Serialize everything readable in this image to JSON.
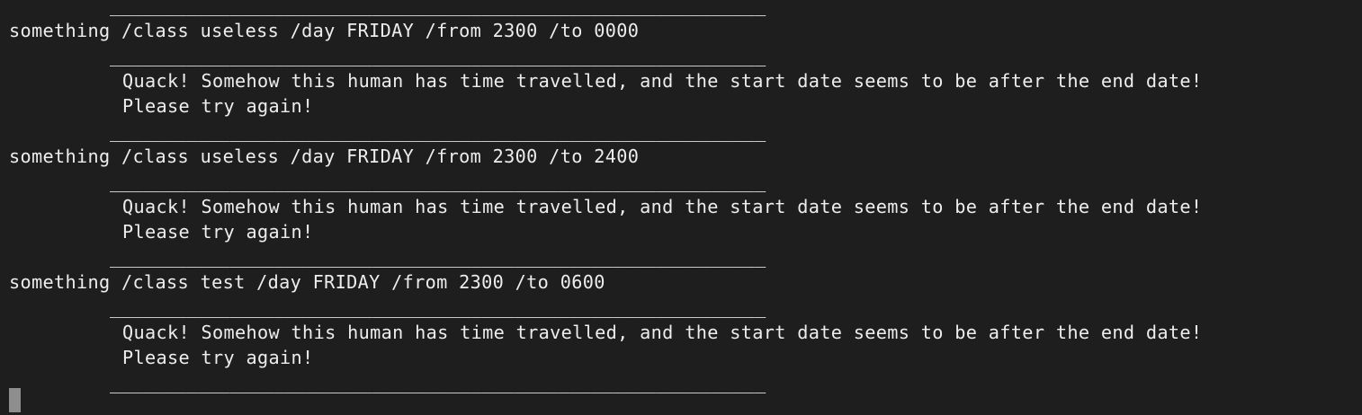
{
  "terminal": {
    "divider": "____________________________________________________________",
    "blocks": [
      {
        "command": "something /class useless /day FRIDAY /from 2300 /to 0000",
        "message_line1": "Quack! Somehow this human has time travelled, and the start date seems to be after the end date!",
        "message_line2": "Please try again!"
      },
      {
        "command": "something /class useless /day FRIDAY /from 2300 /to 2400",
        "message_line1": "Quack! Somehow this human has time travelled, and the start date seems to be after the end date!",
        "message_line2": "Please try again!"
      },
      {
        "command": "something /class test /day FRIDAY /from 2300 /to 0600",
        "message_line1": "Quack! Somehow this human has time travelled, and the start date seems to be after the end date!",
        "message_line2": "Please try again!"
      }
    ]
  },
  "colors": {
    "background": "#1e1e1e",
    "text": "#ededed",
    "cursor": "#8e8e8e"
  }
}
